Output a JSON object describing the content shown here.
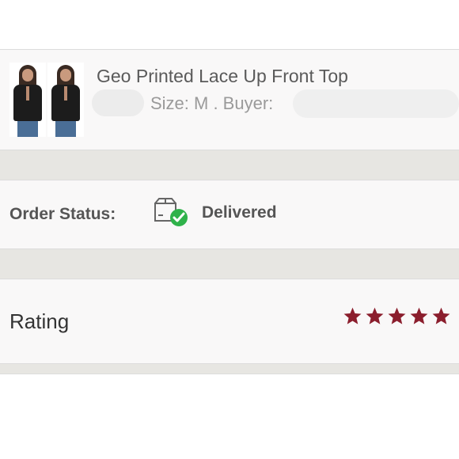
{
  "product": {
    "title": "Geo Printed Lace Up Front Top",
    "size_text": "Size: M . Buyer:"
  },
  "order_status": {
    "label": "Order Status:",
    "value": "Delivered",
    "icon": "package-delivered-icon",
    "check_color": "#2fb24a"
  },
  "rating": {
    "label": "Rating",
    "stars": 5,
    "max_stars": 5,
    "star_color": "#8b1e2d"
  }
}
